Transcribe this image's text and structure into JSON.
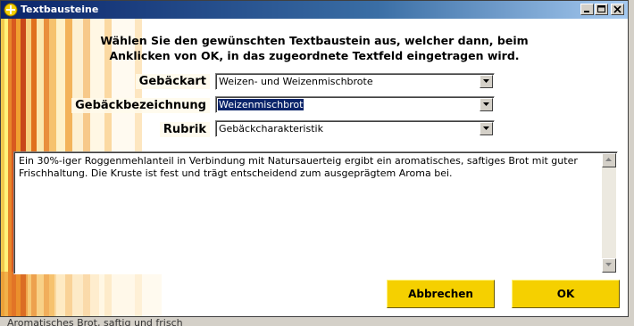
{
  "window": {
    "title": "Textbausteine",
    "controls": [
      "minimize",
      "maximize",
      "close"
    ]
  },
  "instruction": {
    "line1": "Wählen Sie den gewünschten Textbaustein aus, welcher dann, beim",
    "line2": "Anklicken von OK, in das zugeordnete Textfeld eingetragen wird."
  },
  "fields": {
    "gebaeckart": {
      "label": "Gebäckart",
      "value": "Weizen- und Weizenmischbrote"
    },
    "gebaeckbezeichnung": {
      "label": "Gebäckbezeichnung",
      "value": "Weizenmischbrot"
    },
    "rubrik": {
      "label": "Rubrik",
      "value": "Gebäckcharakteristik"
    }
  },
  "text_content": "Ein 30%-iger Roggenmehlanteil in Verbindung mit Natursauerteig ergibt ein aromatisches, saftiges Brot mit guter Frischhaltung. Die Kruste ist fest und trägt entscheidend zum ausgeprägtem Aroma bei.",
  "buttons": {
    "cancel": "Abbrechen",
    "ok": "OK"
  },
  "background_partial_text": "Aromatisches Brot, saftig und frisch"
}
